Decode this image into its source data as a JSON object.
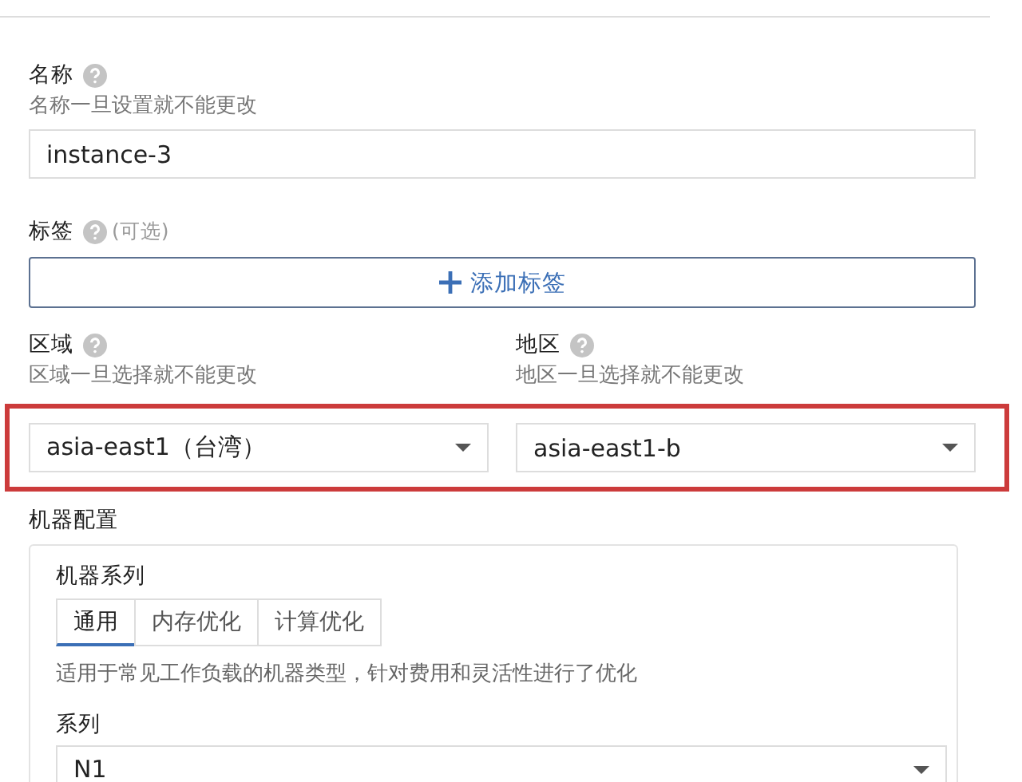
{
  "name_field": {
    "label": "名称",
    "hint": "名称一旦设置就不能更改",
    "value": "instance-3"
  },
  "labels_field": {
    "label": "标签",
    "optional": "(可选)",
    "button": "添加标签"
  },
  "region_field": {
    "label": "区域",
    "hint": "区域一旦选择就不能更改",
    "value": "asia-east1（台湾）"
  },
  "zone_field": {
    "label": "地区",
    "hint": "地区一旦选择就不能更改",
    "value": "asia-east1-b"
  },
  "machine_config": {
    "title": "机器配置",
    "family_label": "机器系列",
    "tabs": [
      {
        "label": "通用",
        "selected": true
      },
      {
        "label": "内存优化",
        "selected": false
      },
      {
        "label": "计算优化",
        "selected": false
      }
    ],
    "description": "适用于常见工作负载的机器类型，针对费用和灵活性进行了优化",
    "series_label": "系列",
    "series_value": "N1"
  }
}
